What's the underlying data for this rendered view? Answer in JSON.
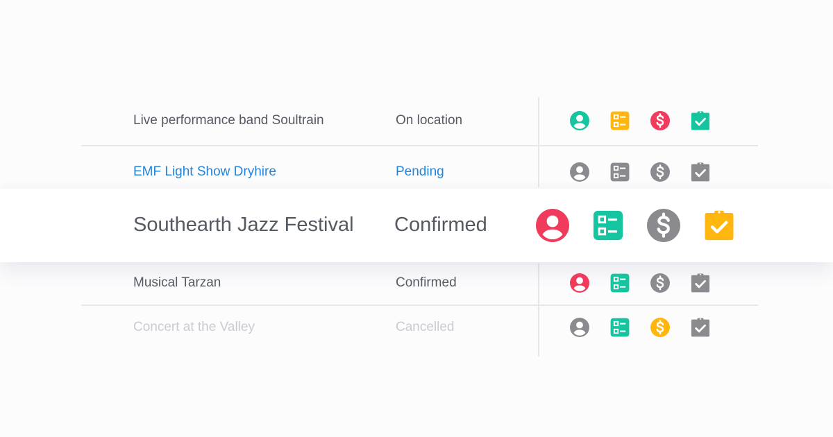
{
  "rows": [
    {
      "name": "Live performance band Soultrain",
      "status": "On location",
      "text_color": "#555a62",
      "icons": [
        {
          "name": "person-icon",
          "color": "#14c5a0"
        },
        {
          "name": "checklist-icon",
          "color": "#ffb70f"
        },
        {
          "name": "dollar-icon",
          "color": "#f03b5c"
        },
        {
          "name": "clipboard-check-icon",
          "color": "#14c5a0"
        }
      ]
    },
    {
      "name": "EMF Light Show Dryhire",
      "status": "Pending",
      "text_color": "#2485d8",
      "icons": [
        {
          "name": "person-icon",
          "color": "#8a8a8f"
        },
        {
          "name": "checklist-icon",
          "color": "#8a8a8f"
        },
        {
          "name": "dollar-icon",
          "color": "#8a8a8f"
        },
        {
          "name": "clipboard-check-icon",
          "color": "#8a8a8f"
        }
      ]
    },
    {
      "name": "Southearth Jazz Festival",
      "status": "Confirmed",
      "text_color": "#555a62",
      "icons": [
        {
          "name": "person-icon",
          "color": "#f03b5c"
        },
        {
          "name": "checklist-icon",
          "color": "#14c5a0"
        },
        {
          "name": "dollar-icon",
          "color": "#8a8a8f"
        },
        {
          "name": "clipboard-check-icon",
          "color": "#ffb70f"
        }
      ]
    },
    {
      "name": "Musical Tarzan",
      "status": "Confirmed",
      "text_color": "#555a62",
      "icons": [
        {
          "name": "person-icon",
          "color": "#f03b5c"
        },
        {
          "name": "checklist-icon",
          "color": "#14c5a0"
        },
        {
          "name": "dollar-icon",
          "color": "#8a8a8f"
        },
        {
          "name": "clipboard-check-icon",
          "color": "#8a8a8f"
        }
      ]
    },
    {
      "name": "Concert at the Valley",
      "status": "Cancelled",
      "text_color": "#c9cbd1",
      "icons": [
        {
          "name": "person-icon",
          "color": "#8a8a8f"
        },
        {
          "name": "checklist-icon",
          "color": "#14c5a0"
        },
        {
          "name": "dollar-icon",
          "color": "#ffb70f"
        },
        {
          "name": "clipboard-check-icon",
          "color": "#8a8a8f"
        }
      ]
    }
  ]
}
